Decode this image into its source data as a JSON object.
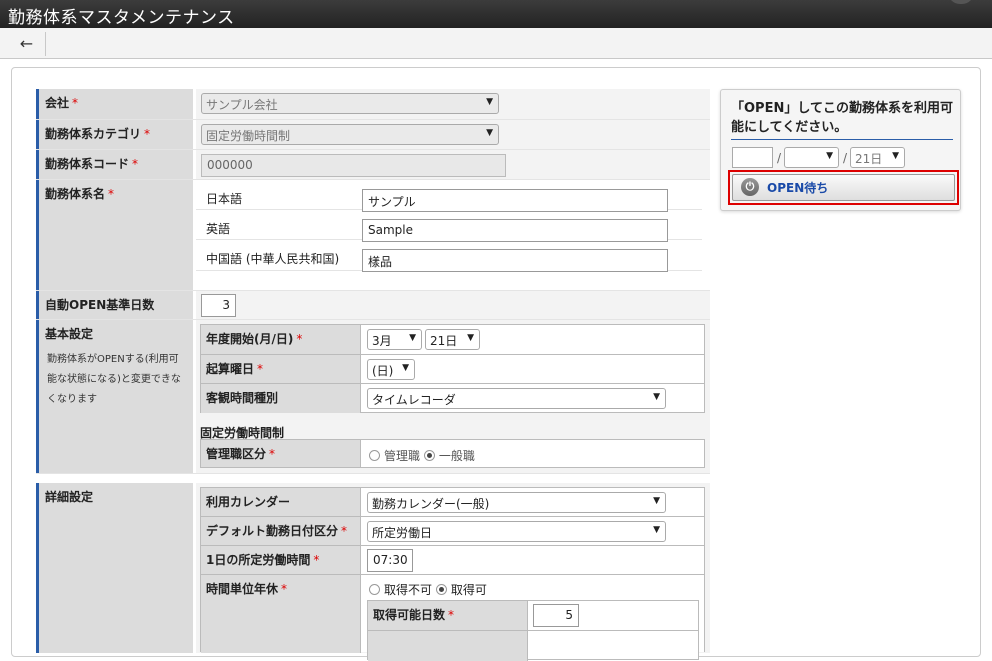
{
  "title": "勤務体系マスタメンテナンス",
  "toolbar": {
    "back_icon": "←"
  },
  "form": {
    "company": {
      "label": "会社",
      "value": "サンプル会社"
    },
    "category": {
      "label": "勤務体系カテゴリ",
      "value": "固定労働時間制"
    },
    "code": {
      "label": "勤務体系コード",
      "value": "000000"
    },
    "name": {
      "label": "勤務体系名",
      "ja_label": "日本語",
      "ja_value": "サンプル",
      "en_label": "英語",
      "en_value": "Sample",
      "zh_label": "中国語 (中華人民共和国)",
      "zh_value": "樣品"
    },
    "auto_open": {
      "label": "自動OPEN基準日数",
      "value": "3"
    },
    "basic": {
      "label": "基本設定",
      "note": "勤務体系がOPENする(利用可能な状態になる)と変更できなくなります",
      "fiscal_start_label": "年度開始(月/日)",
      "fiscal_month": "3月",
      "fiscal_day": "21日",
      "start_weekday_label": "起算曜日",
      "start_weekday": "(日)",
      "objective_time_label": "客観時間種別",
      "objective_time": "タイムレコーダ",
      "fixed_heading": "固定労働時間制",
      "manager_label": "管理職区分",
      "manager_opt1": "管理職",
      "manager_opt2": "一般職"
    },
    "detail": {
      "label": "詳細設定",
      "calendar_label": "利用カレンダー",
      "calendar_value": "勤務カレンダー(一般)",
      "default_day_label": "デフォルト勤務日付区分",
      "default_day_value": "所定労働日",
      "daily_hours_label": "1日の所定労働時間",
      "daily_hours_value": "07:30",
      "hourly_leave_label": "時間単位年休",
      "hourly_opt1": "取得不可",
      "hourly_opt2": "取得可",
      "days_label": "取得可能日数",
      "days_value": "5"
    },
    "required_mark": "*"
  },
  "panel": {
    "message": "「OPEN」してこの勤務体系を利用可能にしてください。",
    "date_sep": "/",
    "day_value": "21日",
    "open_label": "OPEN待ち"
  }
}
